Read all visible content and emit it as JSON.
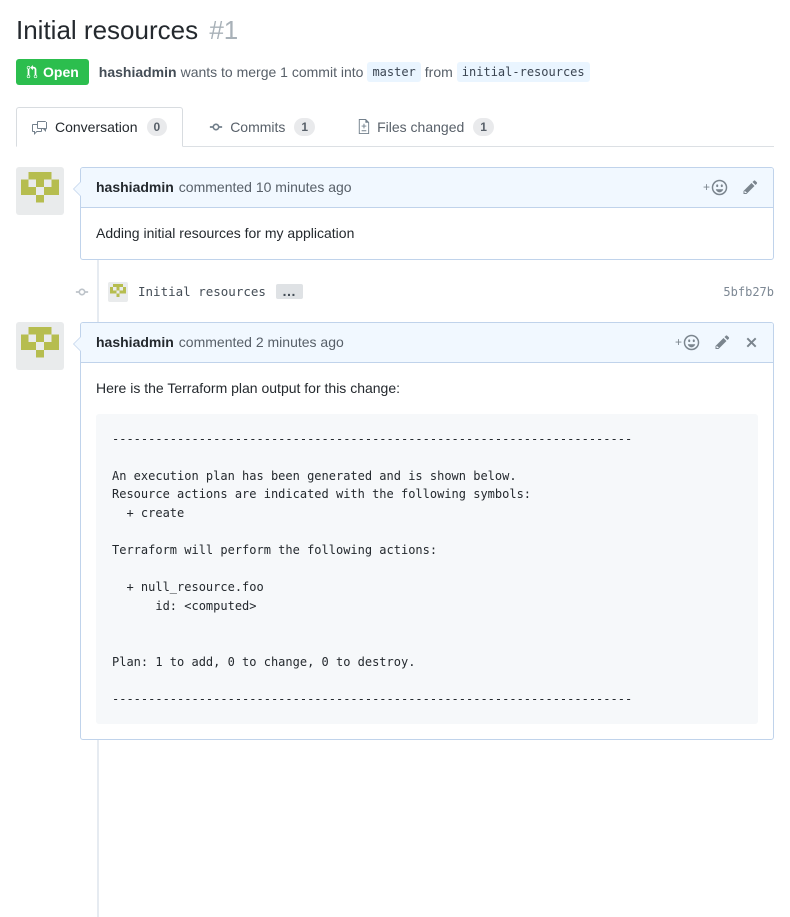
{
  "header": {
    "title": "Initial resources",
    "number": "#1",
    "state_label": "Open",
    "author": "hashiadmin",
    "merge_text_1": "wants to merge 1 commit into",
    "base_branch": "master",
    "merge_text_2": "from",
    "head_branch": "initial-resources"
  },
  "tabs": [
    {
      "label": "Conversation",
      "count": "0"
    },
    {
      "label": "Commits",
      "count": "1"
    },
    {
      "label": "Files changed",
      "count": "1"
    }
  ],
  "comments": [
    {
      "author": "hashiadmin",
      "meta": "commented 10 minutes ago",
      "body": "Adding initial resources for my application"
    },
    {
      "author": "hashiadmin",
      "meta": "commented 2 minutes ago",
      "body": "Here is the Terraform plan output for this change:",
      "code": "------------------------------------------------------------------------\n\nAn execution plan has been generated and is shown below.\nResource actions are indicated with the following symbols:\n  + create\n\nTerraform will perform the following actions:\n\n  + null_resource.foo\n      id: <computed>\n\n\nPlan: 1 to add, 0 to change, 0 to destroy.\n\n------------------------------------------------------------------------"
    }
  ],
  "commit": {
    "message": "Initial resources",
    "ellipsis": "…",
    "sha": "5bfb27b"
  },
  "icons": {
    "state_badge": "git-pull-request",
    "tab_conversation": "comment-discussion",
    "tab_commits": "git-commit",
    "tab_files_changed": "file-diff",
    "reaction": "smiley-plus",
    "edit": "pencil",
    "delete": "x",
    "commit_timeline": "git-commit",
    "avatar": "identicon"
  },
  "colors": {
    "open_badge_green": "#2cbe4e",
    "comment_border_blue": "#c0d3eb",
    "comment_header_bg": "#f1f8ff",
    "branch_ref_bg": "#eaf5ff",
    "code_block_bg": "#f6f8fa",
    "identicon_olive": "#b6bd4f",
    "timeline_line": "#e6ebf1"
  }
}
